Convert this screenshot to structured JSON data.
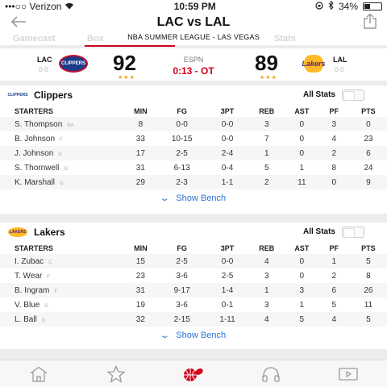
{
  "status": {
    "carrier": "•••○○ Verizon",
    "time": "10:59 PM",
    "battery": "34%"
  },
  "nav": {
    "title": "LAC vs LAL"
  },
  "tabs_ghost": [
    "Gamecast",
    "Box",
    "Stats"
  ],
  "league": "NBA SUMMER LEAGUE - LAS VEGAS",
  "score": {
    "home": {
      "abbr": "LAC",
      "record": "0-0",
      "logo": "CLIPPERS",
      "score": "92",
      "stars": "★★★"
    },
    "away": {
      "abbr": "LAL",
      "record": "0-0",
      "logo": "Lakers",
      "score": "89",
      "stars": "★★★"
    },
    "network": "ESPN",
    "clock": "0:13 - OT"
  },
  "headers": [
    "STARTERS",
    "MIN",
    "FG",
    "3PT",
    "REB",
    "AST",
    "PF",
    "PTS"
  ],
  "clippers": {
    "name": "Clippers",
    "logo": "CLIPPERS",
    "all_stats": "All Stats",
    "players": [
      {
        "name": "S. Thompson",
        "pos": "NA",
        "min": "8",
        "fg": "0-0",
        "tpt": "0-0",
        "reb": "3",
        "ast": "0",
        "pf": "3",
        "pts": "0"
      },
      {
        "name": "B. Johnson",
        "pos": "F",
        "min": "33",
        "fg": "10-15",
        "tpt": "0-0",
        "reb": "7",
        "ast": "0",
        "pf": "4",
        "pts": "23"
      },
      {
        "name": "J. Johnson",
        "pos": "G",
        "min": "17",
        "fg": "2-5",
        "tpt": "2-4",
        "reb": "1",
        "ast": "0",
        "pf": "2",
        "pts": "6"
      },
      {
        "name": "S. Thornwell",
        "pos": "G",
        "min": "31",
        "fg": "6-13",
        "tpt": "0-4",
        "reb": "5",
        "ast": "1",
        "pf": "8",
        "pts": "24"
      },
      {
        "name": "K. Marshall",
        "pos": "G",
        "min": "29",
        "fg": "2-3",
        "tpt": "1-1",
        "reb": "2",
        "ast": "11",
        "pf": "0",
        "pts": "9"
      }
    ],
    "show_bench": "Show Bench"
  },
  "lakers": {
    "name": "Lakers",
    "logo": "LAKERS",
    "all_stats": "All Stats",
    "players": [
      {
        "name": "I. Zubac",
        "pos": "C",
        "min": "15",
        "fg": "2-5",
        "tpt": "0-0",
        "reb": "4",
        "ast": "0",
        "pf": "1",
        "pts": "5"
      },
      {
        "name": "T. Wear",
        "pos": "F",
        "min": "23",
        "fg": "3-6",
        "tpt": "2-5",
        "reb": "3",
        "ast": "0",
        "pf": "2",
        "pts": "8"
      },
      {
        "name": "B. Ingram",
        "pos": "F",
        "min": "31",
        "fg": "9-17",
        "tpt": "1-4",
        "reb": "1",
        "ast": "3",
        "pf": "6",
        "pts": "26"
      },
      {
        "name": "V. Blue",
        "pos": "G",
        "min": "19",
        "fg": "3-6",
        "tpt": "0-1",
        "reb": "3",
        "ast": "1",
        "pf": "5",
        "pts": "11"
      },
      {
        "name": "L. Ball",
        "pos": "G",
        "min": "32",
        "fg": "2-15",
        "tpt": "1-11",
        "reb": "4",
        "ast": "5",
        "pf": "4",
        "pts": "5"
      }
    ],
    "show_bench": "Show Bench"
  },
  "tabbar": {
    "icons": [
      "home-icon",
      "star-icon",
      "scores-icon",
      "audio-icon",
      "video-icon"
    ],
    "active_color": "#d0021b"
  }
}
